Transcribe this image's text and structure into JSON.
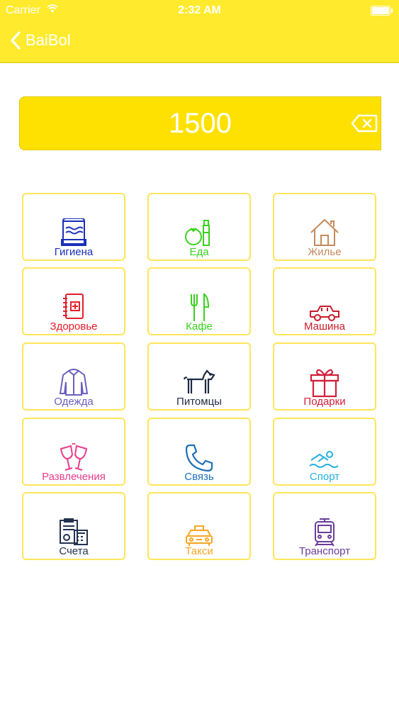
{
  "status_bar": {
    "carrier": "Carrier",
    "time": "2:32 AM",
    "battery_percent": 100
  },
  "nav": {
    "back_label": "BaiBol"
  },
  "amount": {
    "value": "1500"
  },
  "categories": [
    {
      "label": "Гигиена",
      "color": "#1a2fb8",
      "icon": "towel-icon"
    },
    {
      "label": "Еда",
      "color": "#39d11c",
      "icon": "food-icon"
    },
    {
      "label": "Жилье",
      "color": "#c5895b",
      "icon": "house-icon"
    },
    {
      "label": "Здоровье",
      "color": "#e41e2b",
      "icon": "medical-book-icon"
    },
    {
      "label": "Кафе",
      "color": "#39d11c",
      "icon": "fork-knife-icon"
    },
    {
      "label": "Машина",
      "color": "#c71e2b",
      "icon": "car-icon"
    },
    {
      "label": "Одежда",
      "color": "#6b5fbf",
      "icon": "jacket-icon"
    },
    {
      "label": "Питомцы",
      "color": "#1f2a44",
      "icon": "dog-icon"
    },
    {
      "label": "Подарки",
      "color": "#d1203a",
      "icon": "gift-icon"
    },
    {
      "label": "Развлечения",
      "color": "#e93d8a",
      "icon": "wine-glasses-icon"
    },
    {
      "label": "Связь",
      "color": "#1e6fb8",
      "icon": "phone-icon"
    },
    {
      "label": "Спорт",
      "color": "#22b0e0",
      "icon": "swimmer-icon"
    },
    {
      "label": "Счета",
      "color": "#22324f",
      "icon": "bills-icon"
    },
    {
      "label": "Такси",
      "color": "#f5a623",
      "icon": "taxi-icon"
    },
    {
      "label": "Транспорт",
      "color": "#6a3d9a",
      "icon": "tram-icon"
    }
  ]
}
